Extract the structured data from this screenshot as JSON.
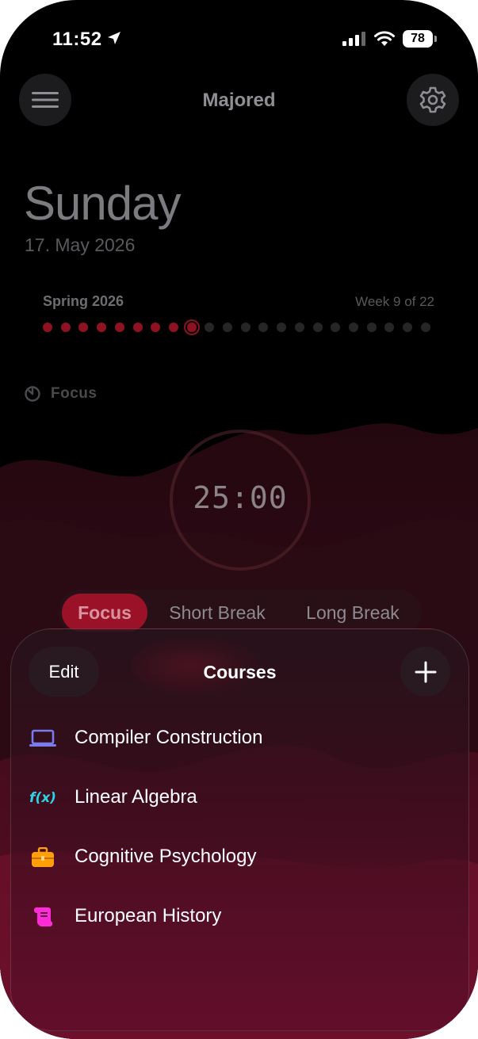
{
  "status_bar": {
    "time": "11:52",
    "battery": "78",
    "icons": [
      "location-arrow-icon",
      "cellular-signal-icon",
      "wifi-icon",
      "battery-icon"
    ]
  },
  "header": {
    "title": "Majored",
    "menu_icon": "hamburger-menu-icon",
    "settings_icon": "gear-icon"
  },
  "date": {
    "weekday": "Sunday",
    "full_date": "17. May 2026"
  },
  "term": {
    "name": "Spring 2026",
    "week_text": "Week 9 of 22",
    "current_week": 9,
    "total_weeks": 22
  },
  "focus_mode": {
    "label": "Focus",
    "icon": "timer-icon"
  },
  "timer": {
    "display": "25:00"
  },
  "mode_tabs": [
    {
      "label": "Focus",
      "active": true
    },
    {
      "label": "Short Break",
      "active": false
    },
    {
      "label": "Long Break",
      "active": false
    }
  ],
  "courses_sheet": {
    "title": "Courses",
    "edit_label": "Edit",
    "add_icon": "plus-icon",
    "items": [
      {
        "label": "Compiler Construction",
        "icon": "laptop-icon",
        "color": "#7b7bf0"
      },
      {
        "label": "Linear Algebra",
        "icon": "function-icon",
        "icon_text": "f(x)",
        "color": "#2fd3e6"
      },
      {
        "label": "Cognitive Psychology",
        "icon": "briefcase-icon",
        "color": "#ff9f0a"
      },
      {
        "label": "European History",
        "icon": "scroll-icon",
        "color": "#ff2bd6"
      }
    ]
  },
  "colors": {
    "accent": "#9b1228",
    "background": "#000000",
    "sheet_tint": "#5f0e2a"
  }
}
